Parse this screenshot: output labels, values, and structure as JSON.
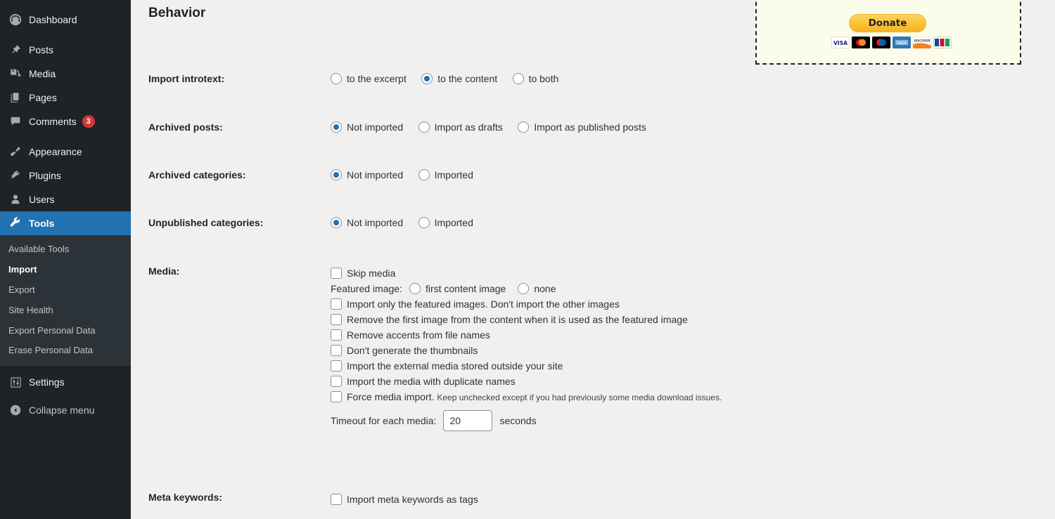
{
  "sidebar": {
    "top_items": [
      {
        "label": "Dashboard",
        "icon": "dashboard-icon",
        "active": false,
        "badge": null
      },
      {
        "label": "Posts",
        "icon": "pin-icon",
        "active": false,
        "badge": null
      },
      {
        "label": "Media",
        "icon": "media-icon",
        "active": false,
        "badge": null
      },
      {
        "label": "Pages",
        "icon": "pages-icon",
        "active": false,
        "badge": null
      },
      {
        "label": "Comments",
        "icon": "comment-icon",
        "active": false,
        "badge": "3"
      },
      {
        "label": "Appearance",
        "icon": "brush-icon",
        "active": false,
        "badge": null
      },
      {
        "label": "Plugins",
        "icon": "plug-icon",
        "active": false,
        "badge": null
      },
      {
        "label": "Users",
        "icon": "user-icon",
        "active": false,
        "badge": null
      },
      {
        "label": "Tools",
        "icon": "wrench-icon",
        "active": true,
        "badge": null
      }
    ],
    "submenu": [
      {
        "label": "Available Tools",
        "current": false
      },
      {
        "label": "Import",
        "current": true
      },
      {
        "label": "Export",
        "current": false
      },
      {
        "label": "Site Health",
        "current": false
      },
      {
        "label": "Export Personal Data",
        "current": false
      },
      {
        "label": "Erase Personal Data",
        "current": false
      }
    ],
    "bottom_items": [
      {
        "label": "Settings",
        "icon": "settings-icon"
      },
      {
        "label": "Collapse menu",
        "icon": "collapse-icon"
      }
    ]
  },
  "donate": {
    "button_label": "Donate",
    "cards": [
      "visa-card-icon",
      "mastercard-card-icon",
      "maestro-card-icon",
      "amex-card-icon",
      "discover-card-icon",
      "jcb-card-icon"
    ]
  },
  "main": {
    "title": "Behavior",
    "rows": [
      {
        "label": "Import introtext:",
        "options": [
          {
            "text": "to the excerpt",
            "checked": false
          },
          {
            "text": "to the content",
            "checked": true
          },
          {
            "text": "to both",
            "checked": false
          }
        ]
      },
      {
        "label": "Archived posts:",
        "options": [
          {
            "text": "Not imported",
            "checked": true
          },
          {
            "text": "Import as drafts",
            "checked": false
          },
          {
            "text": "Import as published posts",
            "checked": false
          }
        ]
      },
      {
        "label": "Archived categories:",
        "options": [
          {
            "text": "Not imported",
            "checked": true
          },
          {
            "text": "Imported",
            "checked": false
          }
        ]
      },
      {
        "label": "Unpublished categories:",
        "options": [
          {
            "text": "Not imported",
            "checked": true
          },
          {
            "text": "Imported",
            "checked": false
          }
        ]
      }
    ],
    "media": {
      "label": "Media:",
      "skip_media": {
        "text": "Skip media",
        "checked": false
      },
      "featured_image": {
        "lead": "Featured image:",
        "options": [
          {
            "text": "first content image",
            "checked": false
          },
          {
            "text": "none",
            "checked": false
          }
        ]
      },
      "checkboxes": [
        {
          "text": "Import only the featured images. Don't import the other images",
          "checked": false
        },
        {
          "text": "Remove the first image from the content when it is used as the featured image",
          "checked": false
        },
        {
          "text": "Remove accents from file names",
          "checked": false
        },
        {
          "text": "Don't generate the thumbnails",
          "checked": false
        },
        {
          "text": "Import the external media stored outside your site",
          "checked": false
        },
        {
          "text": "Import the media with duplicate names",
          "checked": false
        }
      ],
      "force_media": {
        "text": "Force media import.",
        "note": "Keep unchecked except if you had previously some media download issues.",
        "checked": false
      },
      "timeout": {
        "lead": "Timeout for each media:",
        "value": "20",
        "unit": "seconds"
      }
    },
    "meta_keywords": {
      "label": "Meta keywords:",
      "checkbox": {
        "text": "Import meta keywords as tags",
        "checked": false
      }
    }
  },
  "colors": {
    "sidebar_bg": "#1d2327",
    "submenu_bg": "#2c3338",
    "accent": "#2271b1",
    "badge": "#d63638",
    "page_bg": "#f0f0f1",
    "donate_bg": "#fcfceb",
    "donate_btn": "#fbc236"
  }
}
